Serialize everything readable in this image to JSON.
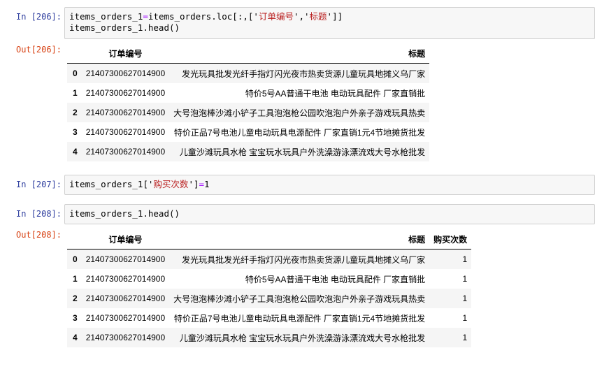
{
  "cells": [
    {
      "in_prompt": "In  [206]:",
      "code_line1": {
        "var": "items_orders_1",
        "eq": "=",
        "expr": "items_orders.loc[:,['",
        "s1": "订单编号",
        "mid": "','",
        "s2": "标题",
        "end": "']]"
      },
      "code_line2": "items_orders_1.head()",
      "out_prompt": "Out[206]:",
      "table": {
        "columns": [
          "订单编号",
          "标题"
        ],
        "rows": [
          {
            "idx": "0",
            "id": "21407300627014900",
            "title": "发光玩具批发光纤手指灯闪光夜市热卖货源儿童玩具地摊义乌厂家"
          },
          {
            "idx": "1",
            "id": "21407300627014900",
            "title": "特价5号AA普通干电池 电动玩具配件 厂家直销批"
          },
          {
            "idx": "2",
            "id": "21407300627014900",
            "title": "大号泡泡棒沙滩小铲子工具泡泡枪公园吹泡泡户外亲子游戏玩具热卖"
          },
          {
            "idx": "3",
            "id": "21407300627014900",
            "title": "特价正品7号电池儿童电动玩具电源配件 厂家直销1元4节地摊货批发"
          },
          {
            "idx": "4",
            "id": "21407300627014900",
            "title": "儿童沙滩玩具水枪 宝宝玩水玩具户外洗澡游泳漂流戏大号水枪批发"
          }
        ]
      }
    },
    {
      "in_prompt": "In  [207]:",
      "code": {
        "pre": "items_orders_1['",
        "s": "购买次数",
        "post": "']",
        "eq": "=",
        "val": "1"
      }
    },
    {
      "in_prompt": "In  [208]:",
      "code_line1": "items_orders_1.head()",
      "out_prompt": "Out[208]:",
      "table": {
        "columns": [
          "订单编号",
          "标题",
          "购买次数"
        ],
        "rows": [
          {
            "idx": "0",
            "id": "21407300627014900",
            "title": "发光玩具批发光纤手指灯闪光夜市热卖货源儿童玩具地摊义乌厂家",
            "count": "1"
          },
          {
            "idx": "1",
            "id": "21407300627014900",
            "title": "特价5号AA普通干电池 电动玩具配件 厂家直销批",
            "count": "1"
          },
          {
            "idx": "2",
            "id": "21407300627014900",
            "title": "大号泡泡棒沙滩小铲子工具泡泡枪公园吹泡泡户外亲子游戏玩具热卖",
            "count": "1"
          },
          {
            "idx": "3",
            "id": "21407300627014900",
            "title": "特价正品7号电池儿童电动玩具电源配件 厂家直销1元4节地摊货批发",
            "count": "1"
          },
          {
            "idx": "4",
            "id": "21407300627014900",
            "title": "儿童沙滩玩具水枪 宝宝玩水玩具户外洗澡游泳漂流戏大号水枪批发",
            "count": "1"
          }
        ]
      }
    }
  ]
}
